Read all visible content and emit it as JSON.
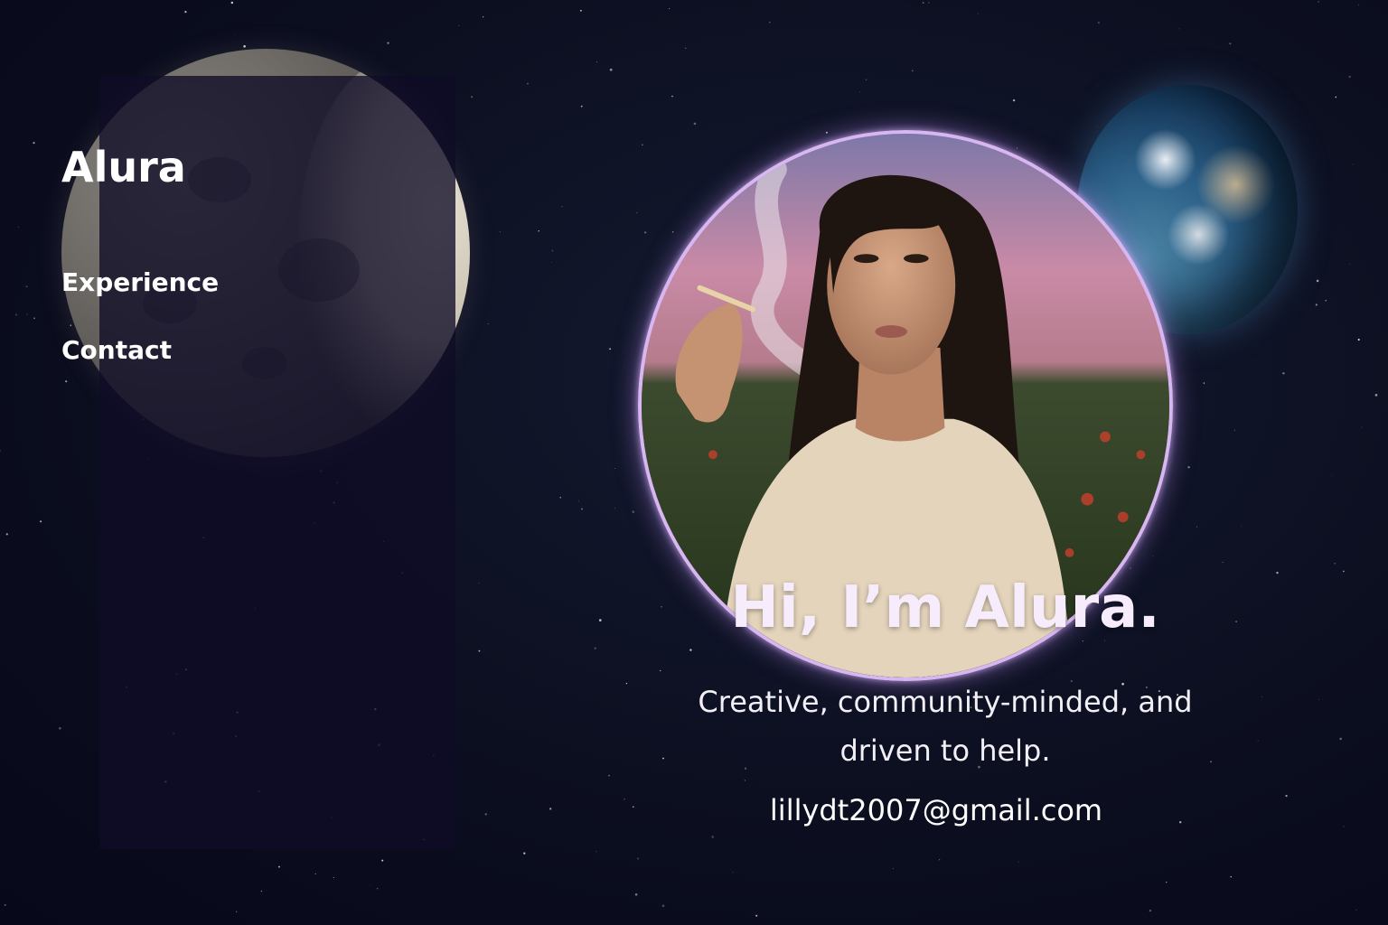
{
  "sidebar": {
    "brand": "Alura",
    "nav": [
      {
        "label": "Experience"
      },
      {
        "label": "Contact"
      }
    ]
  },
  "hero": {
    "title": "Hi, I’m Alura.",
    "tagline": "Creative, community-minded, and driven to help.",
    "email": "lillydt2007@gmail.com"
  },
  "colors": {
    "background": "#0a0c1a",
    "sidebar": "#100c26",
    "portrait_ring": "#d8b6f2",
    "text": "#ffffff"
  },
  "images": {
    "moon": "moon-image",
    "earth": "earth-image",
    "portrait": "portrait-photo"
  }
}
